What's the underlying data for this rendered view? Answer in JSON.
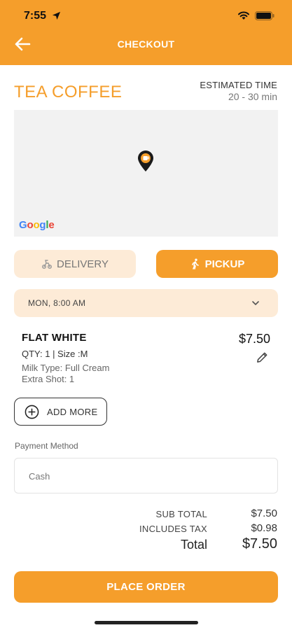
{
  "status_bar": {
    "time": "7:55"
  },
  "header": {
    "title": "CHECKOUT"
  },
  "store": {
    "name": "TEA COFFEE",
    "estimated_label": "ESTIMATED TIME",
    "estimated_value": "20 - 30 min"
  },
  "map": {
    "logo": [
      "G",
      "o",
      "o",
      "g",
      "l",
      "e"
    ],
    "logo_colors": [
      "#4285F4",
      "#EA4335",
      "#FBBC05",
      "#4285F4",
      "#34A853",
      "#EA4335"
    ],
    "pin_color": "#1a1a1a",
    "pin_accent": "#F59E2B"
  },
  "fulfillment": {
    "delivery_label": "DELIVERY",
    "pickup_label": "PICKUP",
    "selected": "pickup"
  },
  "schedule": {
    "value": "MON, 8:00 AM"
  },
  "cart_item": {
    "name": "FLAT WHITE",
    "qty_size": "QTY: 1 | Size :M",
    "option_1": "Milk Type: Full Cream",
    "option_2": "Extra Shot: 1",
    "price": "$7.50"
  },
  "add_more_label": "ADD MORE",
  "payment": {
    "label": "Payment Method",
    "value": "Cash"
  },
  "summary": {
    "subtotal_label": "SUB TOTAL",
    "subtotal_value": "$7.50",
    "tax_label": "INCLUDES TAX",
    "tax_value": "$0.98",
    "total_label": "Total",
    "total_value": "$7.50"
  },
  "place_order_label": "PLACE ORDER",
  "colors": {
    "accent": "#F59E2B",
    "accent_light": "#FDEBD7"
  }
}
